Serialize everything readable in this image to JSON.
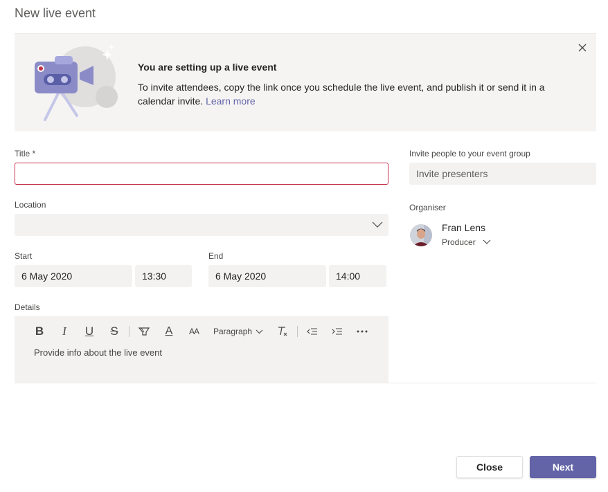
{
  "dialog": {
    "title": "New live event"
  },
  "banner": {
    "heading": "You are setting up a live event",
    "text": "To invite attendees, copy the link once you schedule the live event, and publish it or send it in a calendar invite.",
    "link": "Learn more"
  },
  "form": {
    "title_label": "Title *",
    "title_value": "",
    "location_label": "Location",
    "location_value": "",
    "start_label": "Start",
    "start_date": "6 May 2020",
    "start_time": "13:30",
    "end_label": "End",
    "end_date": "6 May 2020",
    "end_time": "14:00",
    "details_label": "Details",
    "details_placeholder": "Provide info about the live event"
  },
  "toolbar": {
    "bold": "B",
    "italic": "I",
    "underline": "U",
    "strike": "S",
    "font_color": "A",
    "font_size": "AA",
    "paragraph": "Paragraph"
  },
  "invite": {
    "label": "Invite people to your event group",
    "placeholder": "Invite presenters"
  },
  "organiser": {
    "label": "Organiser",
    "name": "Fran Lens",
    "role": "Producer"
  },
  "buttons": {
    "close": "Close",
    "next": "Next"
  },
  "colors": {
    "accent": "#6264a7",
    "error_border": "#c4314b",
    "field_bg": "#f3f2f1"
  }
}
